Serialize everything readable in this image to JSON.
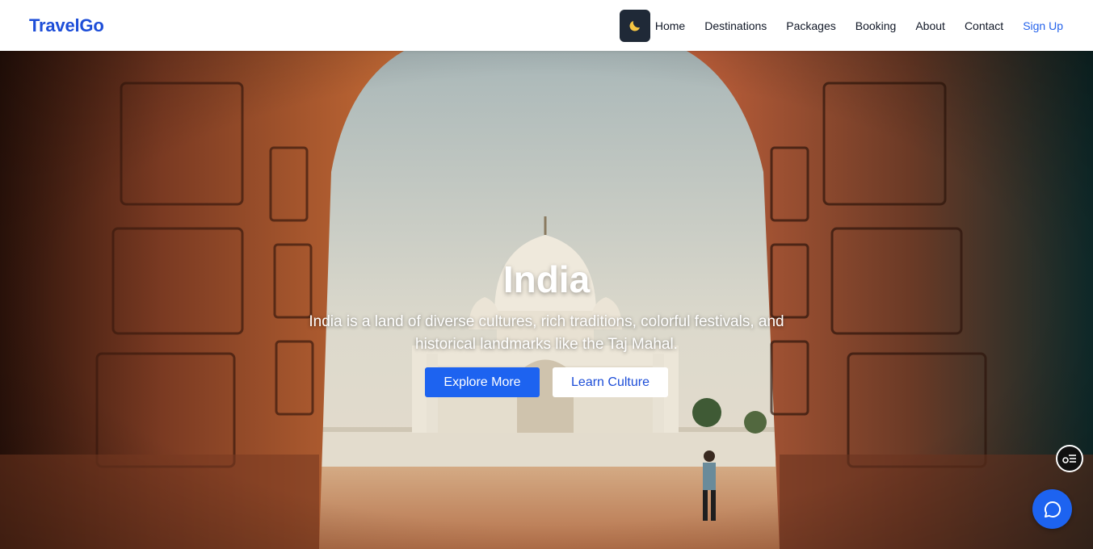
{
  "navbar": {
    "brand": "TravelGo",
    "theme_toggle_icon": "moon-icon",
    "links": [
      "Home",
      "Destinations",
      "Packages",
      "Booking",
      "About",
      "Contact"
    ],
    "signup_label": "Sign Up",
    "accent_color": "#1d4ed8"
  },
  "hero": {
    "title": "India",
    "description": "India is a land of diverse cultures, rich traditions, colorful festivals, and historical landmarks like the Taj Mahal.",
    "primary_button": "Explore More",
    "secondary_button": "Learn Culture",
    "primary_color": "#1d63f0"
  },
  "floating": {
    "menu_icon": "settings-list-icon",
    "chat_icon": "chat-bubble-icon"
  }
}
